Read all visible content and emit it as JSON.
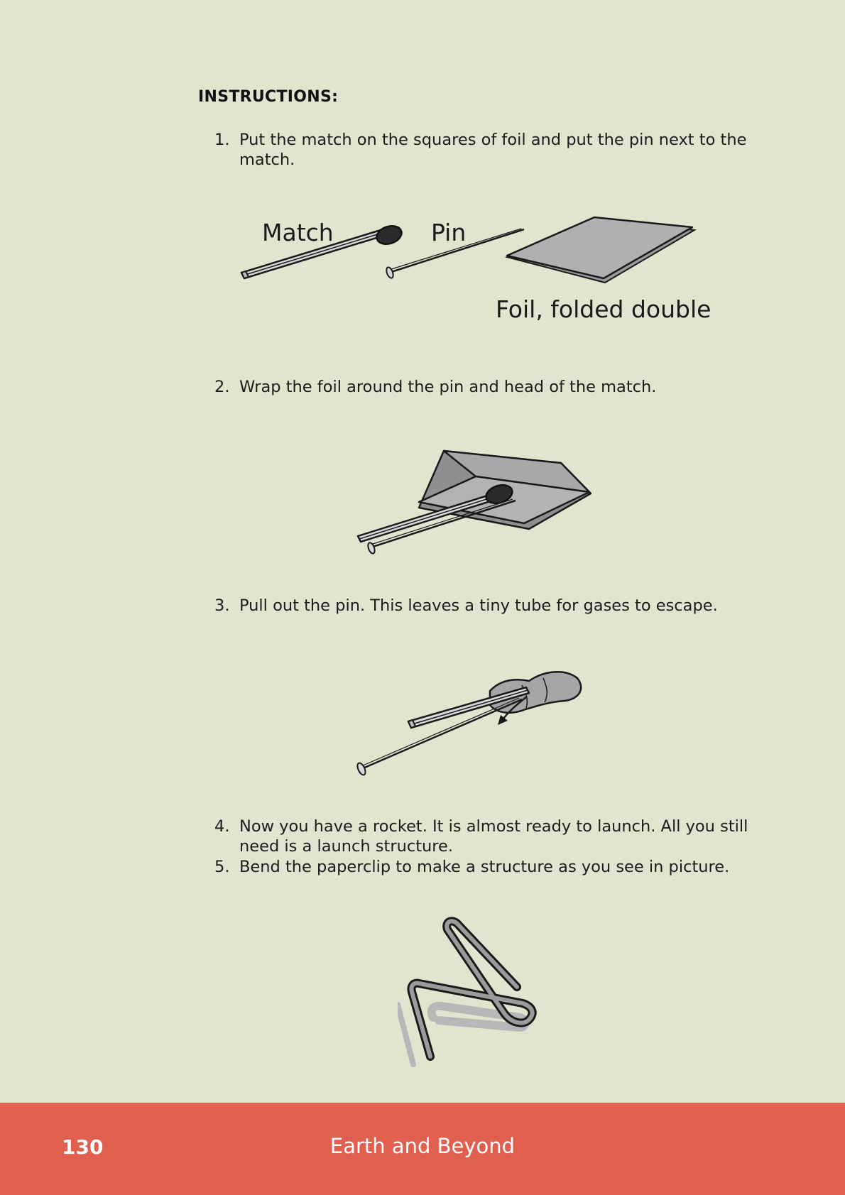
{
  "heading": "INSTRUCTIONS:",
  "steps": [
    {
      "num": "1.",
      "text": "Put the match on the squares of foil and put the pin next to the match."
    },
    {
      "num": "2.",
      "text": "Wrap the foil around the pin and head of the match."
    },
    {
      "num": "3.",
      "text": "Pull out the pin. This leaves a tiny tube for gases to escape."
    },
    {
      "num": "4.",
      "text": "Now you have a rocket. It is almost ready to launch. All you still need is a launch structure."
    },
    {
      "num": "5.",
      "text": "Bend the paperclip to make a structure as you see in picture."
    }
  ],
  "figure1": {
    "match_label": "Match",
    "pin_label": "Pin",
    "foil_label": "Foil, folded double"
  },
  "footer": {
    "page_number": "130",
    "title": "Earth and Beyond"
  },
  "colors": {
    "background": "#e1e5cf",
    "footer": "#e05f4f",
    "foil": "#aaaaaa",
    "match_head": "#2b2b2b"
  }
}
